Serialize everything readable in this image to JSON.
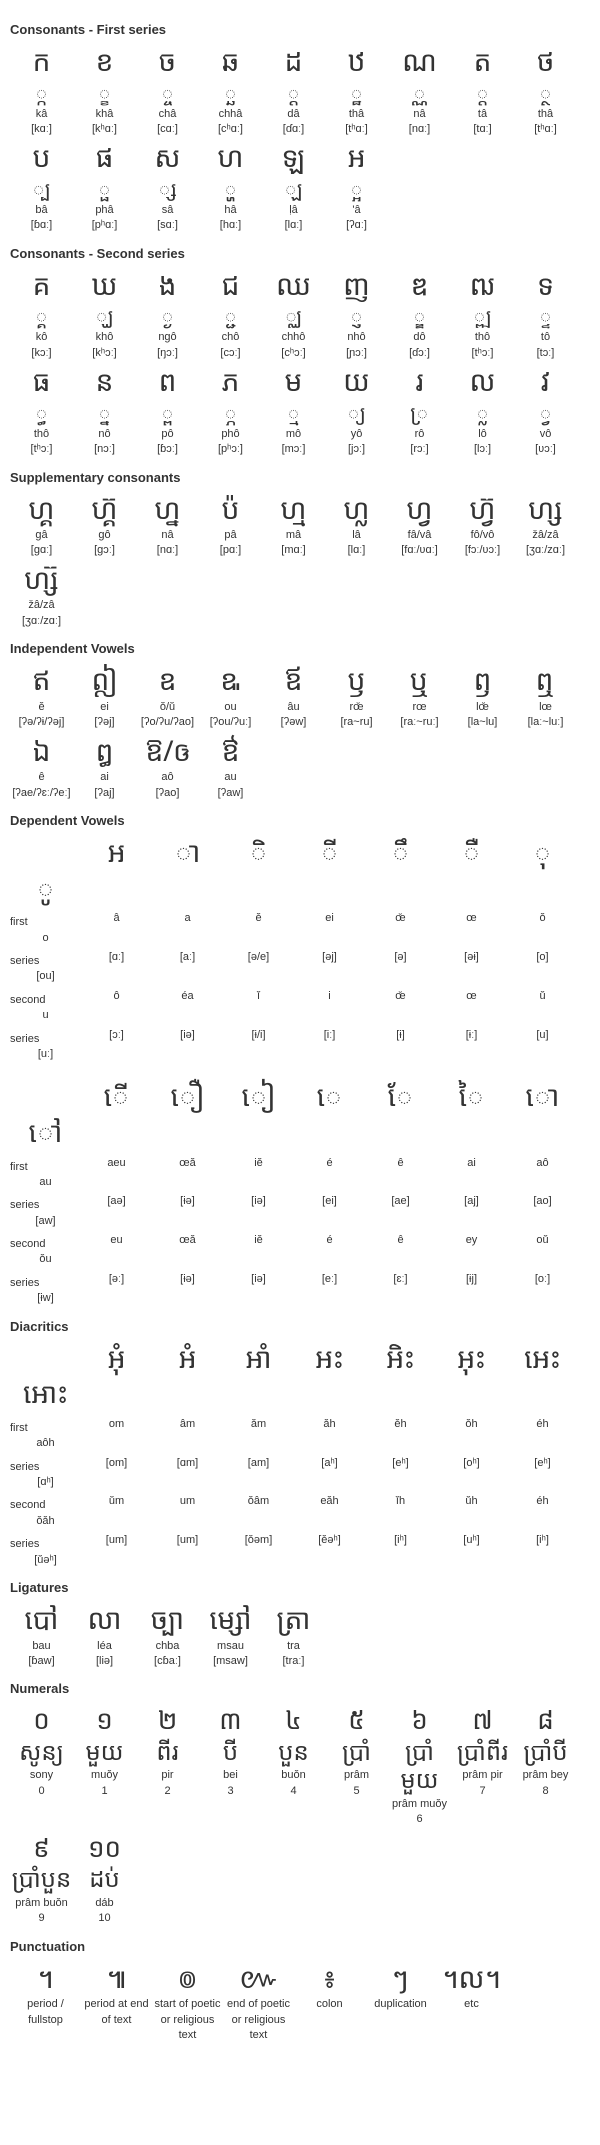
{
  "sections": {
    "cons1_title": "Consonants - First series",
    "cons2_title": "Consonants - Second series",
    "supp_title": "Supplementary consonants",
    "indv_title": "Independent Vowels",
    "depv_title": "Dependent Vowels",
    "diac_title": "Diacritics",
    "lig_title": "Ligatures",
    "num_title": "Numerals",
    "punc_title": "Punctuation"
  },
  "cons1": [
    {
      "g": "ក",
      "s": "្ក",
      "r": "kâ",
      "i": "[kɑː]"
    },
    {
      "g": "ខ",
      "s": "្ខ",
      "r": "khâ",
      "i": "[kʰɑː]"
    },
    {
      "g": "ច",
      "s": "្ច",
      "r": "châ",
      "i": "[cɑː]"
    },
    {
      "g": "ឆ",
      "s": "្ឆ",
      "r": "chhâ",
      "i": "[cʰɑː]"
    },
    {
      "g": "ដ",
      "s": "្ដ",
      "r": "dâ",
      "i": "[ɗɑː]"
    },
    {
      "g": "ឋ",
      "s": "្ឋ",
      "r": "thâ",
      "i": "[tʰɑː]"
    },
    {
      "g": "ណ",
      "s": "្ណ",
      "r": "nâ",
      "i": "[nɑː]"
    },
    {
      "g": "ត",
      "s": "្ត",
      "r": "tâ",
      "i": "[tɑː]"
    },
    {
      "g": "ថ",
      "s": "្ថ",
      "r": "thâ",
      "i": "[tʰɑː]"
    },
    {
      "g": "ប",
      "s": "្ប",
      "r": "bâ",
      "i": "[ɓɑː]"
    },
    {
      "g": "ផ",
      "s": "្ផ",
      "r": "phâ",
      "i": "[pʰɑː]"
    },
    {
      "g": "ស",
      "s": "្ស",
      "r": "sâ",
      "i": "[sɑː]"
    },
    {
      "g": "ហ",
      "s": "្ហ",
      "r": "hâ",
      "i": "[hɑː]"
    },
    {
      "g": "ឡ",
      "s": "្ឡ",
      "r": "ḷâ",
      "i": "[lɑː]"
    },
    {
      "g": "អ",
      "s": "្អ",
      "r": "'â",
      "i": "[ʔɑː]"
    }
  ],
  "cons2": [
    {
      "g": "គ",
      "s": "្គ",
      "r": "kô",
      "i": "[kɔː]"
    },
    {
      "g": "ឃ",
      "s": "្ឃ",
      "r": "khô",
      "i": "[kʰɔː]"
    },
    {
      "g": "ង",
      "s": "្ង",
      "r": "ngô",
      "i": "[ŋɔː]"
    },
    {
      "g": "ជ",
      "s": "្ជ",
      "r": "chô",
      "i": "[cɔː]"
    },
    {
      "g": "ឈ",
      "s": "្ឈ",
      "r": "chhô",
      "i": "[cʰɔː]"
    },
    {
      "g": "ញ",
      "s": "្ញ",
      "r": "nhô",
      "i": "[ɲɔː]"
    },
    {
      "g": "ឌ",
      "s": "្ឌ",
      "r": "dô",
      "i": "[ɗɔː]"
    },
    {
      "g": "ឍ",
      "s": "្ឍ",
      "r": "thô",
      "i": "[tʰɔː]"
    },
    {
      "g": "ទ",
      "s": "្ទ",
      "r": "tô",
      "i": "[tɔː]"
    },
    {
      "g": "ធ",
      "s": "្ធ",
      "r": "thô",
      "i": "[tʰɔː]"
    },
    {
      "g": "ន",
      "s": "្ន",
      "r": "nô",
      "i": "[nɔː]"
    },
    {
      "g": "ព",
      "s": "្ព",
      "r": "pô",
      "i": "[ɓɔː]"
    },
    {
      "g": "ភ",
      "s": "្ភ",
      "r": "phô",
      "i": "[pʰɔː]"
    },
    {
      "g": "ម",
      "s": "្ម",
      "r": "mô",
      "i": "[mɔː]"
    },
    {
      "g": "យ",
      "s": "្យ",
      "r": "yô",
      "i": "[jɔː]"
    },
    {
      "g": "រ",
      "s": "្រ",
      "r": "rô",
      "i": "[rɔː]"
    },
    {
      "g": "ល",
      "s": "្ល",
      "r": "lô",
      "i": "[lɔː]"
    },
    {
      "g": "វ",
      "s": "្វ",
      "r": "vô",
      "i": "[ʋɔː]"
    }
  ],
  "supp": [
    {
      "g": "ហ្គ",
      "r": "gâ",
      "i": "[gɑː]"
    },
    {
      "g": "ហ្គ៊",
      "r": "gô",
      "i": "[gɔː]"
    },
    {
      "g": "ហ្ន",
      "r": "nâ",
      "i": "[nɑː]"
    },
    {
      "g": "ប៉",
      "r": "pâ",
      "i": "[pɑː]"
    },
    {
      "g": "ហ្ម",
      "r": "mâ",
      "i": "[mɑː]"
    },
    {
      "g": "ហ្ល",
      "r": "lâ",
      "i": "[lɑː]"
    },
    {
      "g": "ហ្វ",
      "r": "fâ/vâ",
      "i": "[fɑː/ʋɑː]"
    },
    {
      "g": "ហ្វ៊",
      "r": "fô/vô",
      "i": "[fɔː/ʋɔː]"
    },
    {
      "g": "ហ្ស",
      "r": "žâ/zâ",
      "i": "[ʒɑː/zɑː]"
    },
    {
      "g": "ហ្ស៊",
      "r": "žâ/zâ",
      "i": "[ʒɑː/zɑː]"
    }
  ],
  "indv": [
    {
      "g": "ឥ",
      "r": "ĕ",
      "i": "[ʔə/ʔɨ/ʔəj]"
    },
    {
      "g": "ឦ",
      "r": "ei",
      "i": "[ʔəj]"
    },
    {
      "g": "ឧ",
      "r": "ŏ/ŭ",
      "i": "[ʔo/ʔu/ʔao]"
    },
    {
      "g": "ឩ",
      "r": "ou",
      "i": "[ʔou/ʔuː]"
    },
    {
      "g": "ឪ",
      "r": "âu",
      "i": "[ʔəw]"
    },
    {
      "g": "ឫ",
      "r": "rœ̆",
      "i": "[ra~ru]"
    },
    {
      "g": "ឬ",
      "r": "rœ",
      "i": "[raː~ruː]"
    },
    {
      "g": "ឭ",
      "r": "lœ̆",
      "i": "[la~lu]"
    },
    {
      "g": "ឮ",
      "r": "lœ",
      "i": "[laː~luː]"
    },
    {
      "g": "ឯ",
      "r": "ê",
      "i": "[ʔae/ʔɛː/ʔeː]"
    },
    {
      "g": "ឰ",
      "r": "ai",
      "i": "[ʔaj]"
    },
    {
      "g": "ឱ/ឲ",
      "r": "aô",
      "i": "[ʔao]"
    },
    {
      "g": "ឳ",
      "r": "au",
      "i": "[ʔaw]"
    }
  ],
  "depv_labels": {
    "first": "first",
    "series": "series",
    "second": "second"
  },
  "depv1": [
    {
      "g": "អ",
      "f1": "â",
      "f2": "[ɑː]",
      "s1": "ô",
      "s2": "[ɔː]"
    },
    {
      "g": "ា",
      "f1": "a",
      "f2": "[aː]",
      "s1": "éa",
      "s2": "[iə]"
    },
    {
      "g": "ិ",
      "f1": "ĕ",
      "f2": "[ə/e]",
      "s1": "ĭ",
      "s2": "[ɨ/i]"
    },
    {
      "g": "ី",
      "f1": "ei",
      "f2": "[əj]",
      "s1": "i",
      "s2": "[iː]"
    },
    {
      "g": "ឹ",
      "f1": "œ̆",
      "f2": "[ə]",
      "s1": "œ̆",
      "s2": "[ɨ]"
    },
    {
      "g": "ឺ",
      "f1": "œ",
      "f2": "[əɨ]",
      "s1": "œ",
      "s2": "[ɨː]"
    },
    {
      "g": "ុ",
      "f1": "ŏ",
      "f2": "[o]",
      "s1": "ŭ",
      "s2": "[u]"
    },
    {
      "g": "ូ",
      "f1": "o",
      "f2": "[ou]",
      "s1": "u",
      "s2": "[uː]"
    }
  ],
  "depv2": [
    {
      "g": "ើ",
      "f1": "aeu",
      "f2": "[aə]",
      "s1": "eu",
      "s2": "[əː]"
    },
    {
      "g": "ឿ",
      "f1": "œă",
      "f2": "[ɨə]",
      "s1": "œă",
      "s2": "[ɨə]"
    },
    {
      "g": "ៀ",
      "f1": "iĕ",
      "f2": "[iə]",
      "s1": "iĕ",
      "s2": "[iə]"
    },
    {
      "g": "េ",
      "f1": "é",
      "f2": "[ei]",
      "s1": "é",
      "s2": "[eː]"
    },
    {
      "g": "ែ",
      "f1": "ê",
      "f2": "[ae]",
      "s1": "ê",
      "s2": "[ɛː]"
    },
    {
      "g": "ៃ",
      "f1": "ai",
      "f2": "[aj]",
      "s1": "ey",
      "s2": "[ɨj]"
    },
    {
      "g": "ោ",
      "f1": "aô",
      "f2": "[ao]",
      "s1": "oŭ",
      "s2": "[oː]"
    },
    {
      "g": "ៅ",
      "f1": "au",
      "f2": "[aw]",
      "s1": "ŏu",
      "s2": "[ɨw]"
    }
  ],
  "diac": [
    {
      "g": "អុំ",
      "f1": "om",
      "f2": "[om]",
      "s1": "ŭm",
      "s2": "[um]"
    },
    {
      "g": "អំ",
      "f1": "âm",
      "f2": "[ɑm]",
      "s1": "um",
      "s2": "[um]"
    },
    {
      "g": "អាំ",
      "f1": "ăm",
      "f2": "[am]",
      "s1": "ŏâm",
      "s2": "[ŏəm]"
    },
    {
      "g": "អះ",
      "f1": "ăh",
      "f2": "[aʰ]",
      "s1": "eăh",
      "s2": "[ĕəʰ]"
    },
    {
      "g": "អិះ",
      "f1": "ĕh",
      "f2": "[eʰ]",
      "s1": "ĭh",
      "s2": "[iʰ]"
    },
    {
      "g": "អុះ",
      "f1": "ŏh",
      "f2": "[oʰ]",
      "s1": "ŭh",
      "s2": "[uʰ]"
    },
    {
      "g": "អេះ",
      "f1": "éh",
      "f2": "[eʰ]",
      "s1": "éh",
      "s2": "[iʰ]"
    },
    {
      "g": "អោះ",
      "f1": "aôh",
      "f2": "[ɑʰ]",
      "s1": "ŏăh",
      "s2": "[ŭəʰ]"
    }
  ],
  "lig": [
    {
      "g": "បៅ",
      "r": "bau",
      "i": "[ɓaw]"
    },
    {
      "g": "លា",
      "r": "léa",
      "i": "[liə]"
    },
    {
      "g": "ច្បា",
      "r": "chba",
      "i": "[cɓaː]"
    },
    {
      "g": "ម្សៅ",
      "r": "msau",
      "i": "[msaw]"
    },
    {
      "g": "ត្រា",
      "r": "tra",
      "i": "[traː]"
    }
  ],
  "num": [
    {
      "g": "០",
      "w": "សូន្យ",
      "r": "sony",
      "n": "0"
    },
    {
      "g": "១",
      "w": "មួយ",
      "r": "muŏy",
      "n": "1"
    },
    {
      "g": "២",
      "w": "ពីរ",
      "r": "pir",
      "n": "2"
    },
    {
      "g": "៣",
      "w": "បី",
      "r": "bei",
      "n": "3"
    },
    {
      "g": "៤",
      "w": "បួន",
      "r": "buŏn",
      "n": "4"
    },
    {
      "g": "៥",
      "w": "ប្រាំ",
      "r": "prâm",
      "n": "5"
    },
    {
      "g": "៦",
      "w": "ប្រាំមួយ",
      "r": "prâm muŏy",
      "n": "6"
    },
    {
      "g": "៧",
      "w": "ប្រាំពីរ",
      "r": "prâm pir",
      "n": "7"
    },
    {
      "g": "៨",
      "w": "ប្រាំបី",
      "r": "prâm bey",
      "n": "8"
    },
    {
      "g": "៩",
      "w": "ប្រាំបួន",
      "r": "prâm buŏn",
      "n": "9"
    },
    {
      "g": "១០",
      "w": "ដប់",
      "r": "dáb",
      "n": "10"
    }
  ],
  "punc": [
    {
      "g": "។",
      "d": "period / fullstop"
    },
    {
      "g": "៕",
      "d": "period at end of text"
    },
    {
      "g": "៙",
      "d": "start of poetic or religious text"
    },
    {
      "g": "៚",
      "d": "end of poetic or religious text"
    },
    {
      "g": "៖",
      "d": "colon"
    },
    {
      "g": "ៗ",
      "d": "duplication"
    },
    {
      "g": "។ល។",
      "d": "etc"
    }
  ]
}
